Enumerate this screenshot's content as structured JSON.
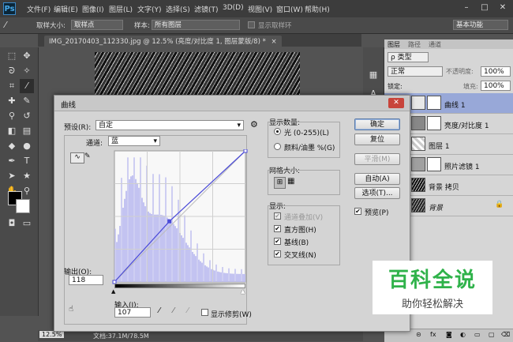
{
  "app": {
    "logo": "Ps"
  },
  "menu": [
    "文件(F)",
    "编辑(E)",
    "图像(I)",
    "图层(L)",
    "文字(Y)",
    "选择(S)",
    "滤镜(T)",
    "3D(D)",
    "视图(V)",
    "窗口(W)",
    "帮助(H)"
  ],
  "window_controls": {
    "minimize": "–",
    "restore": "□",
    "close": "✕"
  },
  "options": {
    "sample_size_label": "取样大小:",
    "sample_size_value": "取样点",
    "sample_label": "样本:",
    "sample_value": "所有图层",
    "show_ring_label": "显示取样环",
    "workspace": "基本功能"
  },
  "document_tab": {
    "title": "IMG_20170403_112330.jpg @ 12.5% (亮度/对比度 1, 图层蒙版/8) *",
    "close": "×"
  },
  "status": {
    "zoom": "12.5%",
    "doc": "文档:37.1M/78.5M"
  },
  "panel_tabs": [
    "图层",
    "路径",
    "通道"
  ],
  "layers_panel": {
    "filter_kind": "ρ 类型",
    "blend_mode": "正常",
    "opacity_label": "不透明度:",
    "opacity_value": "100%",
    "lock_label": "锁定:",
    "fill_label": "填充:",
    "fill_value": "100%",
    "layers": [
      {
        "name": "曲线 1",
        "selected": true
      },
      {
        "name": "亮度/对比度 1",
        "selected": false
      },
      {
        "name": "图层 1",
        "selected": false
      },
      {
        "name": "照片滤镜 1",
        "selected": false
      },
      {
        "name": "背景 拷贝",
        "selected": false
      },
      {
        "name": "背景",
        "selected": false
      }
    ]
  },
  "dialog": {
    "title": "曲线",
    "close": "✕",
    "preset_label": "预设(R):",
    "preset_value": "自定",
    "channel_label": "通道:",
    "channel_value": "蓝",
    "output_label": "输出(O):",
    "output_value": "118",
    "input_label": "输入(I):",
    "input_value": "107",
    "show_clipping_label": "显示修剪(W)",
    "display_amount_title": "显示数量:",
    "light_option": "光 (0-255)(L)",
    "pigment_option": "颜料/油墨 %(G)",
    "grid_size_title": "网格大小:",
    "show_title": "显示:",
    "show_options": [
      "通道叠加(V)",
      "直方图(H)",
      "基线(B)",
      "交叉线(N)"
    ],
    "buttons": {
      "ok": "确定",
      "reset": "复位",
      "smooth": "平滑(M)",
      "auto": "自动(A)",
      "options": "选项(T)..."
    },
    "preview_label": "预览(P)"
  },
  "curve": {
    "input": [
      0,
      107,
      255
    ],
    "output": [
      0,
      118,
      255
    ]
  },
  "watermark": {
    "main": "百科全说",
    "sub": "助你轻松解决"
  },
  "colors": {
    "accent_curve": "#4a4ad8",
    "histogram": "#bcbcf0",
    "selected_layer": "#98a8d8",
    "watermark_green": "#2fb24a"
  }
}
